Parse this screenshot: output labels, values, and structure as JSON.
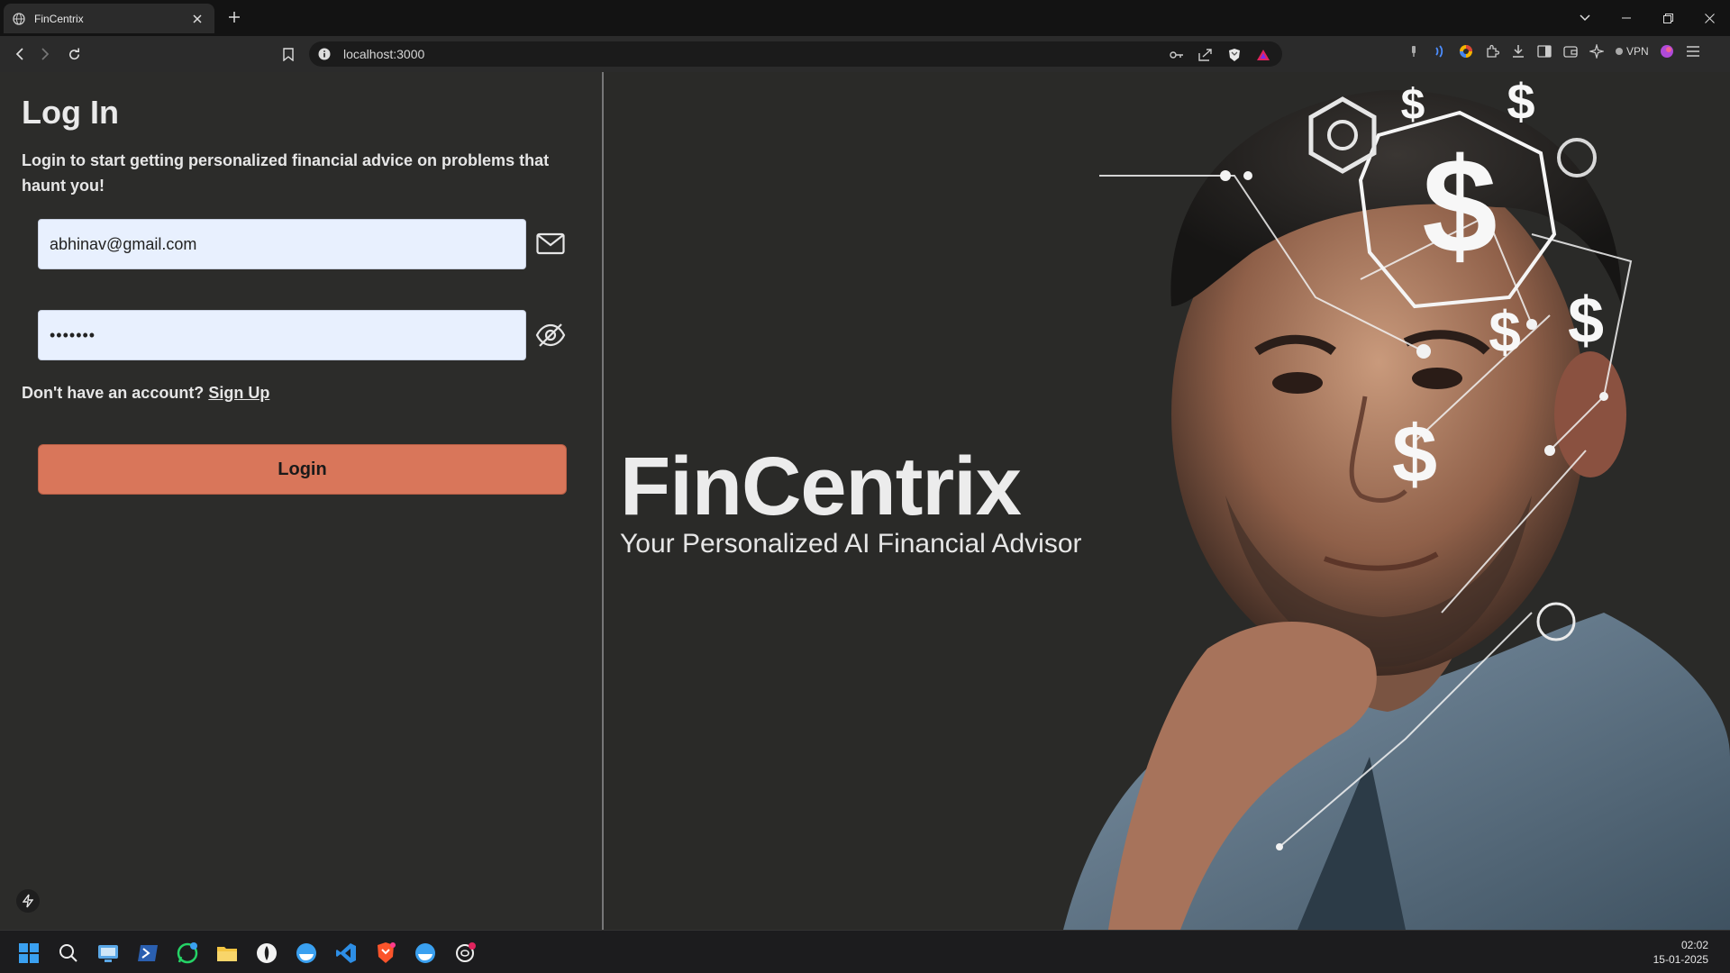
{
  "browser": {
    "tab_title": "FinCentrix",
    "url": "localhost:3000",
    "vpn_label": "VPN"
  },
  "login": {
    "title": "Log In",
    "subtitle": "Login to start getting personalized financial advice on problems that haunt you!",
    "email_value": "abhinav@gmail.com",
    "password_value": "•••••••",
    "no_account_text": "Don't have an account?",
    "signup_link": "Sign Up",
    "login_button": "Login"
  },
  "brand": {
    "name": "FinCentrix",
    "tagline": "Your Personalized AI Financial Advisor"
  },
  "hero_image": {
    "symbols": [
      "$",
      "$",
      "$",
      "$",
      "$",
      "$"
    ]
  },
  "taskbar": {
    "time": "02:02",
    "date": "15-01-2025"
  },
  "colors": {
    "accent": "#d9765a",
    "page_bg": "#2a2a28",
    "input_bg": "#e8f0fe"
  }
}
